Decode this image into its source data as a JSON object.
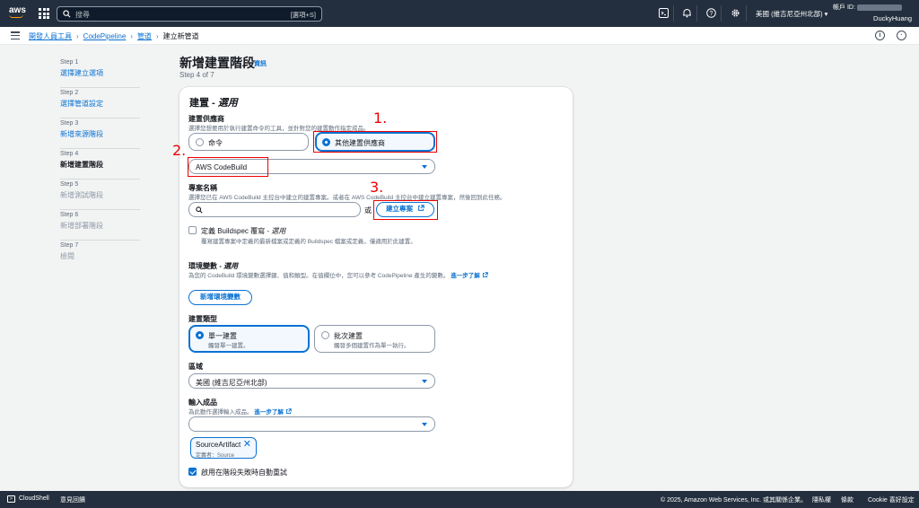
{
  "topnav": {
    "brand": "aws",
    "search_placeholder": "搜尋",
    "search_shortcut": "[選項+S]",
    "region": "美國 (維吉尼亞州北部) ▾",
    "account_label": "帳戶 ID:",
    "username": "DuckyHuang",
    "icons": [
      "cloudshell-icon",
      "bell-icon",
      "help-icon",
      "gear-icon"
    ]
  },
  "breadcrumb": {
    "items": [
      "開發人員工具",
      "CodePipeline",
      "管道"
    ],
    "current": "建立新管道"
  },
  "steps": [
    {
      "num": "Step 1",
      "label": "選擇建立選項",
      "state": "link"
    },
    {
      "num": "Step 2",
      "label": "選擇管道設定",
      "state": "link"
    },
    {
      "num": "Step 3",
      "label": "新增來源階段",
      "state": "link"
    },
    {
      "num": "Step 4",
      "label": "新增建置階段",
      "state": "active"
    },
    {
      "num": "Step 5",
      "label": "新增測試階段",
      "state": "disabled"
    },
    {
      "num": "Step 6",
      "label": "新增部署階段",
      "state": "disabled"
    },
    {
      "num": "Step 7",
      "label": "檢閱",
      "state": "disabled"
    }
  ],
  "page": {
    "title": "新增建置階段",
    "info": "資訊",
    "step": "Step 4 of 7"
  },
  "build": {
    "section_title": "建置 - ",
    "section_optional": "選用",
    "provider_label": "建置供應商",
    "provider_desc": "選擇您想要用於執行建置命令的工具，並針對您的建置動作指定成品。",
    "provider_options": [
      "命令",
      "其他建置供應商"
    ],
    "provider_selected": "其他建置供應商",
    "provider_value": "AWS CodeBuild",
    "project_label": "專案名稱",
    "project_desc": "選擇您已在 AWS CodeBuild 主控台中建立的建置專案。或者在 AWS CodeBuild 主控台中建立建置專案，然後回到此任務。",
    "project_value": "",
    "or_text": "或",
    "create_project_button": "建立專案",
    "buildspec_label": "定義 Buildspec 覆寫 - ",
    "buildspec_optional": "選用",
    "buildspec_desc": "覆寫建置專案中定義的最新檔案或定義的 Buildspec 檔案或定義，僅適用於此建置。",
    "env_label": "環境變數 - ",
    "env_optional": "選用",
    "env_desc": "為您的 CodeBuild 環境變數選擇鍵、值和類型。在值欄位中，您可以參考 CodePipeline 產生的變數。",
    "learn_more": "進一步了解",
    "add_env_button": "新增環境變數",
    "build_type_label": "建置類型",
    "build_types": [
      {
        "label": "單一建置",
        "desc": "觸發單一建置。"
      },
      {
        "label": "批次建置",
        "desc": "觸發多個建置作為單一執行。"
      }
    ],
    "build_type_selected": "單一建置",
    "region_label": "區域",
    "region_value": "美國 (維吉尼亞州北部)",
    "artifacts_label": "輸入成品",
    "artifacts_desc": "為此動作選擇輸入成品。",
    "artifacts_value": "",
    "artifact_token": {
      "name": "SourceArtifact",
      "sub": "定義者：Source"
    },
    "retry_label": "啟用在階段失敗時自動重試",
    "retry_checked": true
  },
  "annotations": [
    "1.",
    "2.",
    "3."
  ],
  "annotation_color": "#e00000",
  "accent_color": "#0972d3",
  "footer": {
    "cloudshell": "CloudShell",
    "feedback": "意見回饋",
    "copyright": "© 2025, Amazon Web Services, Inc. 或其關係企業。",
    "privacy": "隱私權",
    "terms": "條款",
    "cookies": "Cookie 喜好設定"
  }
}
